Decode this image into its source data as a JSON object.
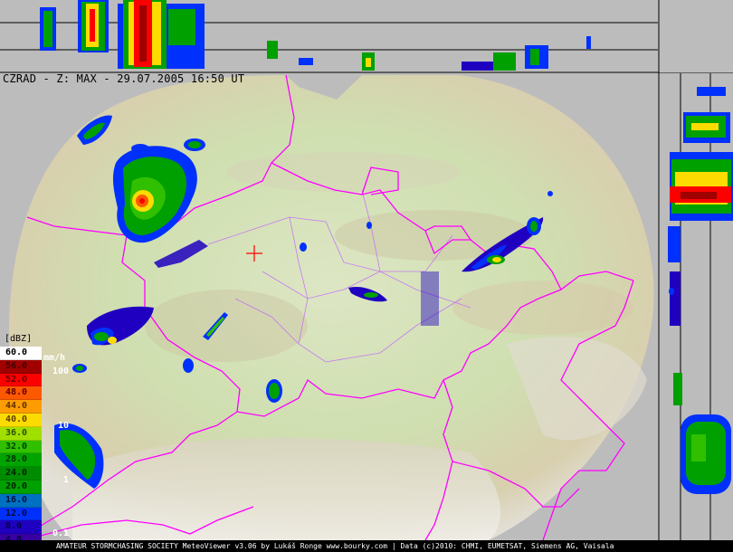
{
  "header": {
    "title": "CZRAD - Z: MAX - 29.07.2005 16:50 UT"
  },
  "legend": {
    "unit": "[dBZ]",
    "rain_unit": "mm/h",
    "levels": [
      {
        "label": "60.0",
        "color": "#ffffff",
        "text": "#000000"
      },
      {
        "label": "56.0",
        "color": "#a00000",
        "text": "#400000"
      },
      {
        "label": "52.0",
        "color": "#fc0000",
        "text": "#600000"
      },
      {
        "label": "48.0",
        "color": "#fc5800",
        "text": "#600000"
      },
      {
        "label": "44.0",
        "color": "#fc9c00",
        "text": "#603000"
      },
      {
        "label": "40.0",
        "color": "#fcdc00",
        "text": "#604000"
      },
      {
        "label": "36.0",
        "color": "#a0e000",
        "text": "#305000"
      },
      {
        "label": "32.0",
        "color": "#30c000",
        "text": "#004000"
      },
      {
        "label": "28.0",
        "color": "#00a400",
        "text": "#003000"
      },
      {
        "label": "24.0",
        "color": "#008c00",
        "text": "#002000"
      },
      {
        "label": "20.0",
        "color": "#00a000",
        "text": "#002000"
      },
      {
        "label": "16.0",
        "color": "#0070c0",
        "text": "#001040"
      },
      {
        "label": "12.0",
        "color": "#0030fc",
        "text": "#000840"
      },
      {
        "label": "8.0",
        "color": "#2000c0",
        "text": "#000040"
      },
      {
        "label": "4.0",
        "color": "#3800a0",
        "text": "#000040"
      }
    ],
    "mmh_values": [
      "100",
      "10",
      "1",
      "0.1"
    ]
  },
  "footer": {
    "credit": "AMATEUR STORMCHASING SOCIETY MeteoViewer v3.06 by Lukáš Ronge www.bourky.com | Data (c)2010: CHMI, EUMETSAT, Siemens AG, Vaisala"
  },
  "map": {
    "radar_site": "crosshair-marker",
    "colors": {
      "border": "#ff00ff",
      "region_border": "#c060ff",
      "terrain": "#cfe0b0"
    }
  }
}
